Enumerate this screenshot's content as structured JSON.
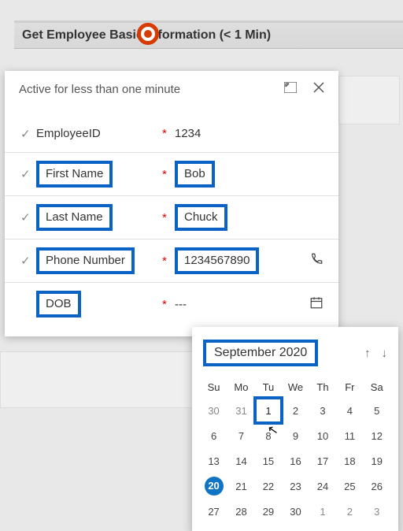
{
  "header": {
    "title": "Get Employee Basic Information  (< 1 Min)"
  },
  "panel": {
    "status": "Active for less than one minute"
  },
  "fields": {
    "employeeId": {
      "label": "EmployeeID",
      "value": "1234"
    },
    "firstName": {
      "label": "First Name",
      "value": "Bob"
    },
    "lastName": {
      "label": "Last Name",
      "value": "Chuck"
    },
    "phone": {
      "label": "Phone Number",
      "value": "1234567890"
    },
    "dob": {
      "label": "DOB",
      "value": "---"
    }
  },
  "datepicker": {
    "title": "September 2020",
    "dayHeaders": [
      "Su",
      "Mo",
      "Tu",
      "We",
      "Th",
      "Fr",
      "Sa"
    ],
    "weeks": [
      [
        {
          "d": "30",
          "muted": true
        },
        {
          "d": "31",
          "muted": true
        },
        {
          "d": "1",
          "boxed": true
        },
        {
          "d": "2"
        },
        {
          "d": "3"
        },
        {
          "d": "4"
        },
        {
          "d": "5"
        }
      ],
      [
        {
          "d": "6"
        },
        {
          "d": "7"
        },
        {
          "d": "8"
        },
        {
          "d": "9"
        },
        {
          "d": "10"
        },
        {
          "d": "11"
        },
        {
          "d": "12"
        }
      ],
      [
        {
          "d": "13"
        },
        {
          "d": "14"
        },
        {
          "d": "15"
        },
        {
          "d": "16"
        },
        {
          "d": "17"
        },
        {
          "d": "18"
        },
        {
          "d": "19"
        }
      ],
      [
        {
          "d": "20",
          "today": true
        },
        {
          "d": "21"
        },
        {
          "d": "22"
        },
        {
          "d": "23"
        },
        {
          "d": "24"
        },
        {
          "d": "25"
        },
        {
          "d": "26"
        }
      ],
      [
        {
          "d": "27"
        },
        {
          "d": "28"
        },
        {
          "d": "29"
        },
        {
          "d": "30"
        },
        {
          "d": "1",
          "muted": true
        },
        {
          "d": "2",
          "muted": true
        },
        {
          "d": "3",
          "muted": true
        }
      ]
    ]
  }
}
